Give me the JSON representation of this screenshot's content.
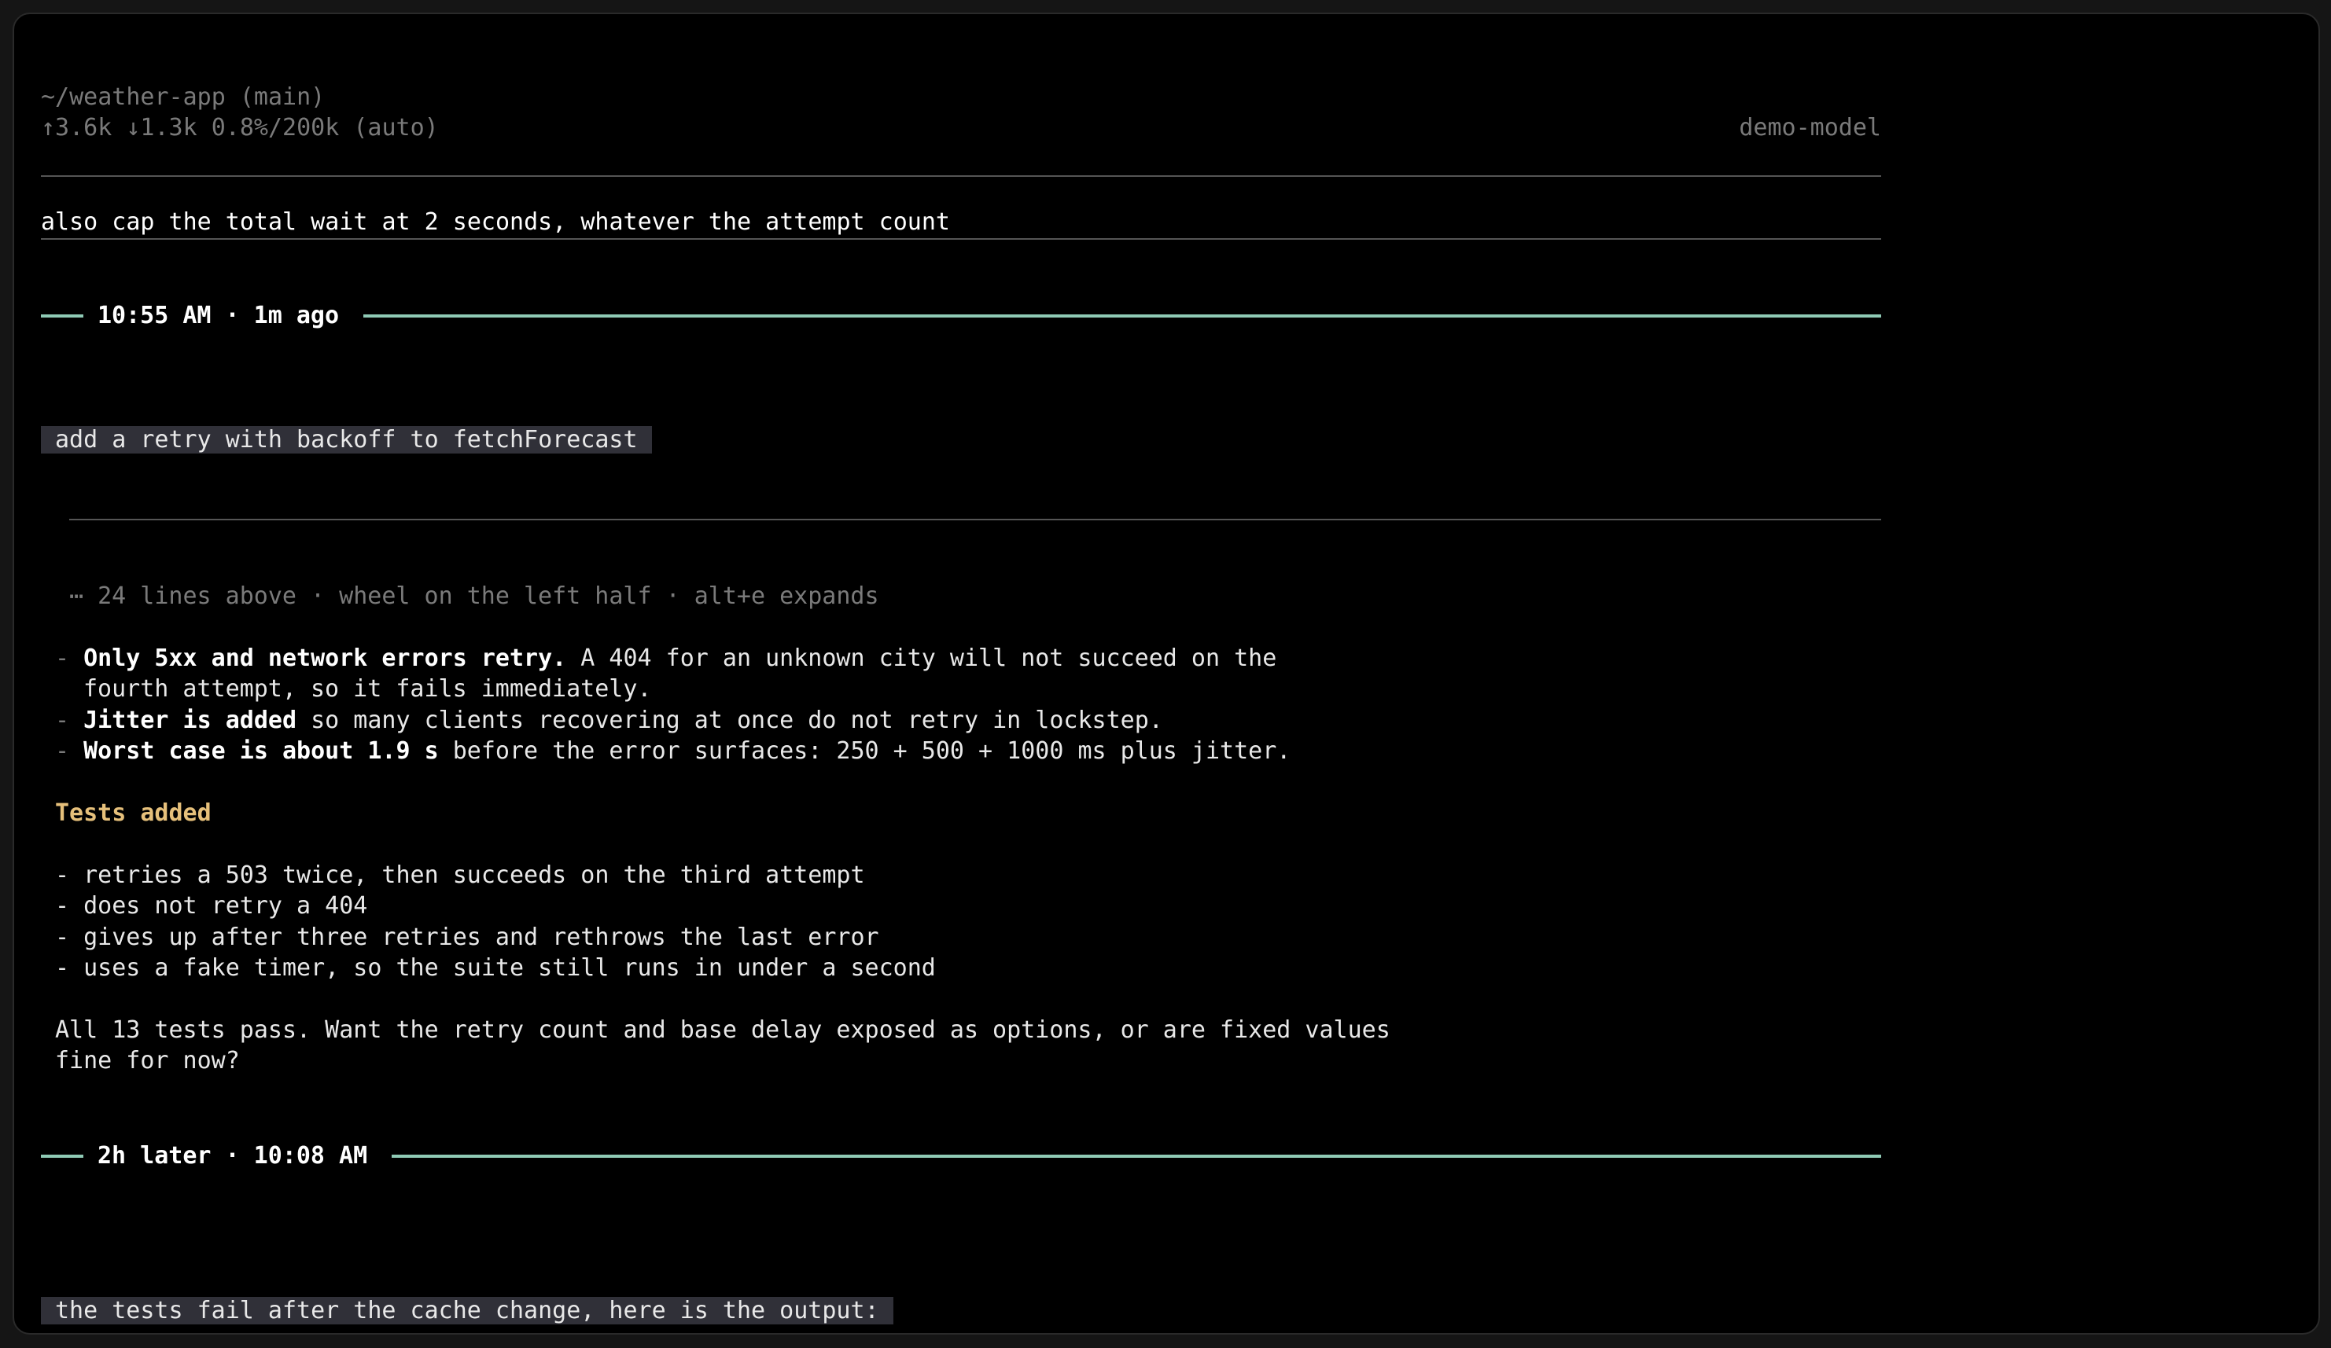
{
  "header": {
    "path": "~/weather-app (main)",
    "stats": "↑3.6k ↓1.3k 0.8%/200k (auto)",
    "model": "demo-model"
  },
  "input": {
    "text": "also cap the total wait at 2 seconds, whatever the attempt count"
  },
  "turn1": {
    "separator_label": "10:55 AM · 1m ago",
    "user_message": "add a retry with backoff to fetchForecast",
    "collapsed_note": "⋯ 24 lines above · wheel on the left half · alt+e expands",
    "bullets": [
      {
        "bold": "Only 5xx and network errors retry.",
        "text": " A 404 for an unknown city will not succeed on the",
        "continuation": "fourth attempt, so it fails immediately."
      },
      {
        "bold": "Jitter is added",
        "text": " so many clients recovering at once do not retry in lockstep."
      },
      {
        "bold": "Worst case is about 1.9 s",
        "text": " before the error surfaces: 250 + 500 + 1000 ms plus jitter."
      }
    ],
    "tests_heading": "Tests added",
    "tests": [
      "retries a 503 twice, then succeeds on the third attempt",
      "does not retry a 404",
      "gives up after three retries and rethrows the last error",
      "uses a fake timer, so the suite still runs in under a second"
    ],
    "closing_line1": "All 13 tests pass. Want the retry count and base delay exposed as options, or are fixed values",
    "closing_line2": "fine for now?"
  },
  "turn2": {
    "separator_label": "2h later · 10:08 AM",
    "user_message": "the tests fail after the cache change, here is the output:"
  },
  "colors": {
    "background": "#000000",
    "separator_accent": "#8fcab5",
    "heading_accent": "#e6c07b",
    "user_highlight": "#303038",
    "dim_text": "#7a7a7a"
  }
}
